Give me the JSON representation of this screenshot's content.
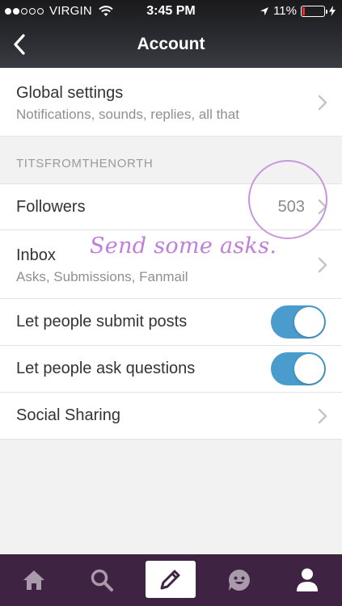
{
  "status_bar": {
    "carrier": "VIRGIN",
    "time": "3:45 PM",
    "battery": "11%",
    "battery_level": 0.11
  },
  "nav": {
    "title": "Account",
    "back_icon": "chevron-left-icon"
  },
  "global_settings": {
    "title": "Global settings",
    "subtitle": "Notifications, sounds, replies, all that"
  },
  "blog_section": {
    "header": "TITSFROMTHENORTH"
  },
  "followers": {
    "title": "Followers",
    "count": "503"
  },
  "inbox": {
    "title": "Inbox",
    "subtitle": "Asks, Submissions, Fanmail"
  },
  "submit_posts": {
    "title": "Let people submit posts",
    "enabled": true
  },
  "ask_questions": {
    "title": "Let people ask questions",
    "enabled": true
  },
  "social_sharing": {
    "title": "Social Sharing"
  },
  "annotation": {
    "text": "Send some asks."
  },
  "tab_bar": {
    "items": [
      "home-icon",
      "search-icon",
      "compose-icon",
      "activity-icon",
      "account-icon"
    ]
  },
  "colors": {
    "header_bg": "#2a2b30",
    "toggle_on": "#4a9ccc",
    "tab_bar_bg": "#3f2342",
    "annotation": "#c07fd8",
    "battery_low": "#e5302f"
  }
}
